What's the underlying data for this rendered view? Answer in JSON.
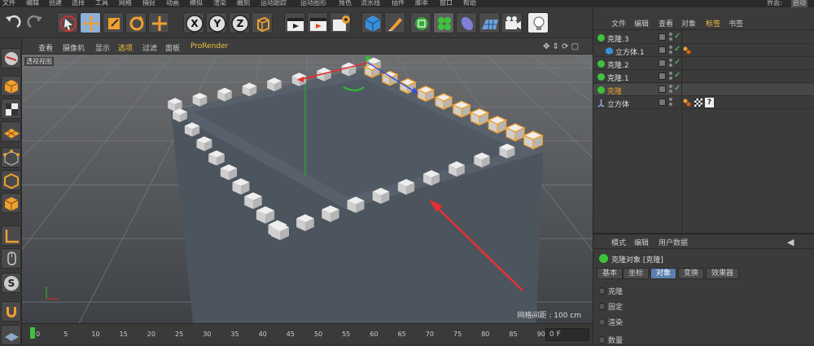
{
  "menubar": {
    "items": [
      "文件",
      "编辑",
      "创建",
      "选择",
      "工具",
      "网格",
      "捕捉",
      "动画",
      "模拟",
      "渲染",
      "雕刻",
      "运动跟踪",
      "运动图形",
      "角色",
      "流水线",
      "插件",
      "脚本",
      "窗口",
      "帮助"
    ],
    "right_label": "界面:",
    "right_value": "启动"
  },
  "toolbar": {
    "icons": [
      "undo-icon",
      "redo-icon",
      "select-icon",
      "move-icon",
      "scale-icon",
      "rotate-icon",
      "move-axis-icon",
      "x-axis-icon",
      "y-axis-icon",
      "z-axis-icon",
      "coordinate-icon",
      "render-view-icon",
      "render-picture-icon",
      "render-settings-icon",
      "cube-icon",
      "pen-icon",
      "subdivision-icon",
      "cloner-icon",
      "deformer-icon",
      "floor-icon",
      "camera-icon",
      "light-icon"
    ],
    "axis_x": "X",
    "axis_y": "Y",
    "axis_z": "Z"
  },
  "viewport_menu": {
    "items": [
      "查看",
      "摄像机",
      "显示",
      "选项",
      "过滤",
      "面板",
      "ProRender"
    ],
    "label": "透视视图",
    "grid_info": "网格间距 : 100 cm"
  },
  "timeline": {
    "ticks": [
      "0",
      "5",
      "10",
      "15",
      "20",
      "25",
      "30",
      "35",
      "40",
      "45",
      "50",
      "55",
      "60",
      "65",
      "70",
      "75",
      "80",
      "85",
      "90"
    ],
    "frame": "0 F"
  },
  "object_manager": {
    "menu": [
      "文件",
      "编辑",
      "查看",
      "对象",
      "标签",
      "书签"
    ],
    "rows": [
      {
        "name": "克隆.3",
        "type": "cloner"
      },
      {
        "name": "立方体.1",
        "type": "cube"
      },
      {
        "name": "克隆.2",
        "type": "cloner"
      },
      {
        "name": "克隆.1",
        "type": "cloner"
      },
      {
        "name": "克隆",
        "type": "cloner"
      },
      {
        "name": "立方体",
        "type": "cube"
      }
    ]
  },
  "attributes": {
    "menu": [
      "模式",
      "编辑",
      "用户数据"
    ],
    "title": "克隆对象 [克隆]",
    "tabs": [
      "基本",
      "坐标",
      "对象",
      "变换",
      "效果器"
    ],
    "active_tab": "对象",
    "params": [
      "克隆",
      "固定",
      "渲染",
      "数量"
    ]
  },
  "colors": {
    "accent": "#f0a030",
    "selection": "#5c7fb0",
    "arrow": "#e83030"
  }
}
